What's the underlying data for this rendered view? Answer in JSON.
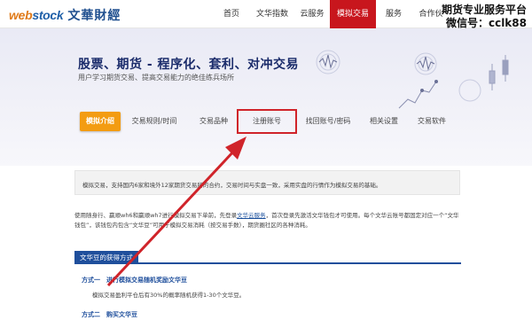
{
  "header": {
    "logo_en_a": "web",
    "logo_en_b": "stock",
    "logo_cn": "文華財經",
    "nav": [
      "首页",
      "文华指数",
      "云服务",
      "模拟交易",
      "服务",
      "合作伙"
    ]
  },
  "watermark": {
    "line1": "期货专业服务平台",
    "line2": "微信号：cclk88"
  },
  "banner": {
    "title": "股票、期货 - 程序化、套利、对冲交易",
    "subtitle": "用户学习期货交易、提高交易能力的绝佳练兵场所"
  },
  "tabs": [
    "模拟介绍",
    "交易规则/时间",
    "交易品种",
    "注册账号",
    "找回账号/密码",
    "相关设置",
    "交易软件"
  ],
  "content": {
    "intro": "模拟交易，支持国内6家和境外12家期货交易所的合约，交易时间与实盘一致，采用实盘的行情作为模拟交易的基础。",
    "para_before": "使用随身行、赢顺wh6和赢顺wh7进行模拟交易下单前，先登录",
    "para_link": "文华云服务",
    "para_after": "，首次登录先激活文华钱包才可使用。每个文华云账号都固定对应一个“文华钱包”，该钱包内包含“文华豆”可用于模拟交易消耗（按交易手数），期货圈社区的各种消耗。",
    "section_title": "文华豆的获得方式",
    "method1_title": "方式一　进行模拟交易随机奖励文华豆",
    "method1_text": "模拟交易盈利平仓后有30%的概率随机获得1-30个文华豆。",
    "method2_title": "方式二　购买文华豆"
  },
  "colors": {
    "nav_active": "#c8161d",
    "tab_active": "#f39c12",
    "highlight_box": "#d0242a",
    "arrow": "#d0242a",
    "section_blue": "#1f4f9c"
  }
}
